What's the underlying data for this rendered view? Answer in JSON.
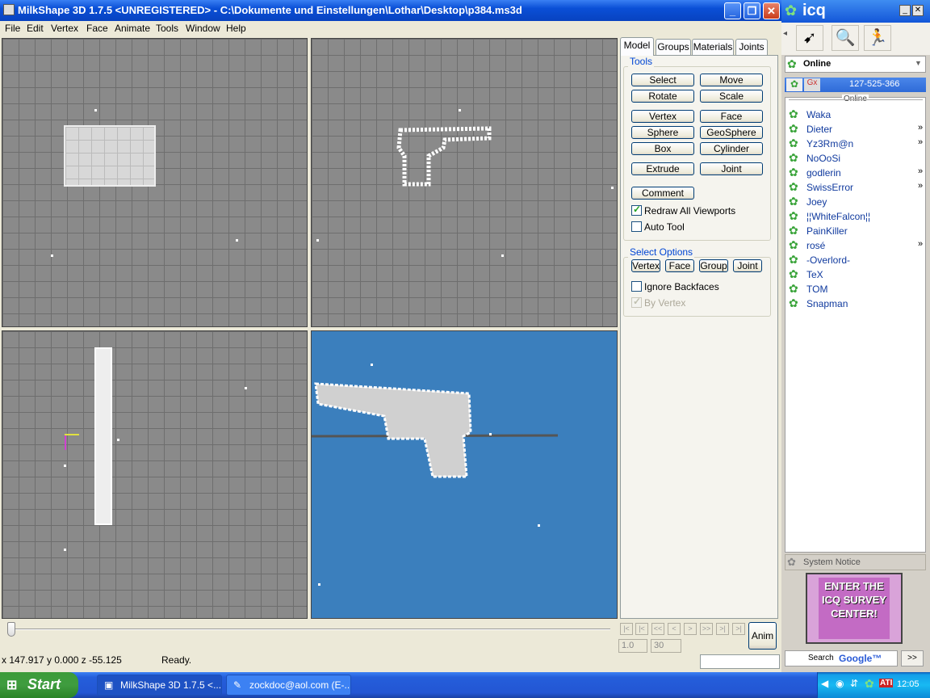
{
  "milkshape": {
    "title": "MilkShape 3D 1.7.5 <UNREGISTERED> - C:\\Dokumente und Einstellungen\\Lothar\\Desktop\\p384.ms3d",
    "menu": [
      "File",
      "Edit",
      "Vertex",
      "Face",
      "Animate",
      "Tools",
      "Window",
      "Help"
    ],
    "tabs": [
      "Model",
      "Groups",
      "Materials",
      "Joints"
    ],
    "tools_group": "Tools",
    "tool_buttons": [
      "Select",
      "Move",
      "Rotate",
      "Scale",
      "Vertex",
      "Face",
      "Sphere",
      "GeoSphere",
      "Box",
      "Cylinder",
      "Extrude",
      "Joint"
    ],
    "comment_button": "Comment",
    "redraw_label": "Redraw All Viewports",
    "auto_tool_label": "Auto Tool",
    "select_options_group": "Select Options",
    "select_option_buttons": [
      "Vertex",
      "Face",
      "Group",
      "Joint"
    ],
    "ignore_backfaces_label": "Ignore Backfaces",
    "by_vertex_label": "By Vertex",
    "anim_button": "Anim",
    "frame_start": "1.0",
    "frame_end": "30",
    "nav_buttons": [
      "|<",
      "|<",
      "<<",
      "<",
      ">",
      ">>",
      ">|",
      ">|"
    ],
    "status_coords": "x 147.917 y 0.000 z -55.125",
    "status_text": "Ready.",
    "viewport_3d_color": "#3b7fbd"
  },
  "icq": {
    "logo": "icq",
    "status": "Online",
    "uin": "127-525-366",
    "section": "Online",
    "contacts": [
      {
        "name": "Waka",
        "more": ""
      },
      {
        "name": "Dieter",
        "more": "»"
      },
      {
        "name": "Yz3Rm@n",
        "more": "»"
      },
      {
        "name": "NoOoSi",
        "more": ""
      },
      {
        "name": "godlerin",
        "more": "»"
      },
      {
        "name": "SwissError",
        "more": "»"
      },
      {
        "name": "Joey",
        "more": ""
      },
      {
        "name": "¦¦WhiteFalcon¦¦",
        "more": ""
      },
      {
        "name": "PainKiller",
        "more": ""
      },
      {
        "name": "rosé",
        "more": "»"
      },
      {
        "name": "-Overlord-",
        "more": ""
      },
      {
        "name": "TeX",
        "more": ""
      },
      {
        "name": "TOM",
        "more": ""
      },
      {
        "name": "Snapman",
        "more": ""
      }
    ],
    "system_notice": "System Notice",
    "ad_text": "ENTER THE ICQ SURVEY CENTER!",
    "search_label": "Search",
    "search_brand": "Google™",
    "search_go": ">>"
  },
  "taskbar": {
    "start": "Start",
    "tasks": [
      "MilkShape 3D 1.7.5 <...",
      "zockdoc@aol.com (E-..."
    ],
    "tray_time": "12:05",
    "tray_ati": "ATI"
  }
}
